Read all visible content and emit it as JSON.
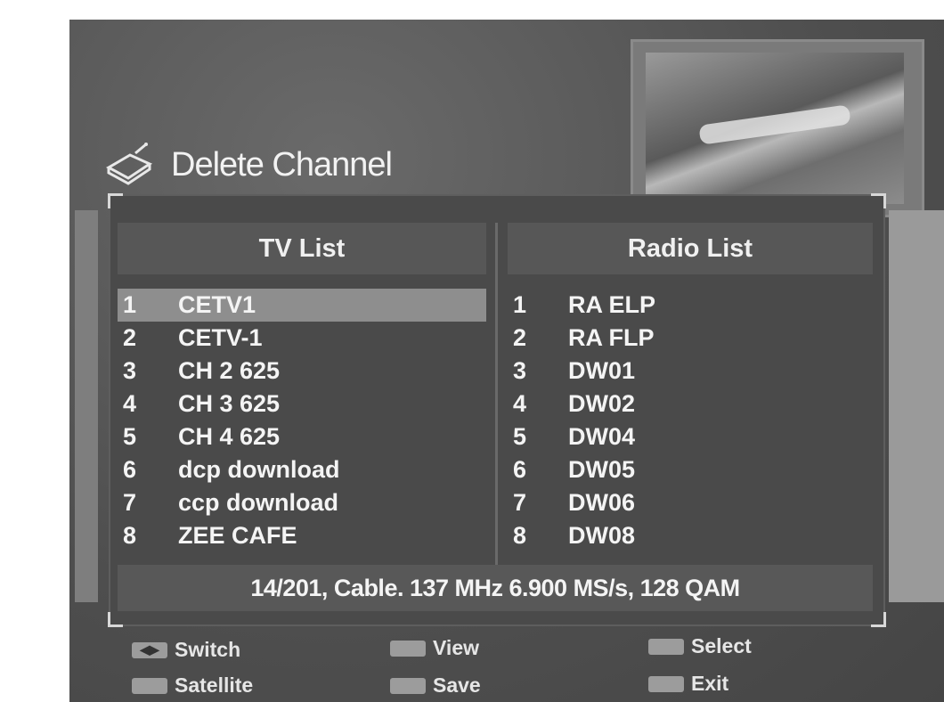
{
  "title": "Delete Channel",
  "tv_list": {
    "header": "TV List",
    "items": [
      {
        "num": "1",
        "name": "CETV1"
      },
      {
        "num": "2",
        "name": "CETV-1"
      },
      {
        "num": "3",
        "name": "CH 2 625"
      },
      {
        "num": "4",
        "name": "CH 3 625"
      },
      {
        "num": "5",
        "name": "CH 4 625"
      },
      {
        "num": "6",
        "name": "dcp download"
      },
      {
        "num": "7",
        "name": "ccp download"
      },
      {
        "num": "8",
        "name": "ZEE CAFE"
      }
    ],
    "selected_index": 0
  },
  "radio_list": {
    "header": "Radio List",
    "items": [
      {
        "num": "1",
        "name": "RA ELP"
      },
      {
        "num": "2",
        "name": "RA FLP"
      },
      {
        "num": "3",
        "name": "DW01"
      },
      {
        "num": "4",
        "name": "DW02"
      },
      {
        "num": "5",
        "name": "DW04"
      },
      {
        "num": "6",
        "name": "DW05"
      },
      {
        "num": "7",
        "name": "DW06"
      },
      {
        "num": "8",
        "name": "DW08"
      }
    ]
  },
  "status": "14/201, Cable. 137 MHz 6.900 MS/s, 128 QAM",
  "footer": {
    "switch": "Switch",
    "view": "View",
    "select": "Select",
    "satellite": "Satellite",
    "save": "Save",
    "exit": "Exit"
  },
  "icons": {
    "title_icon": "tv-box-icon"
  }
}
